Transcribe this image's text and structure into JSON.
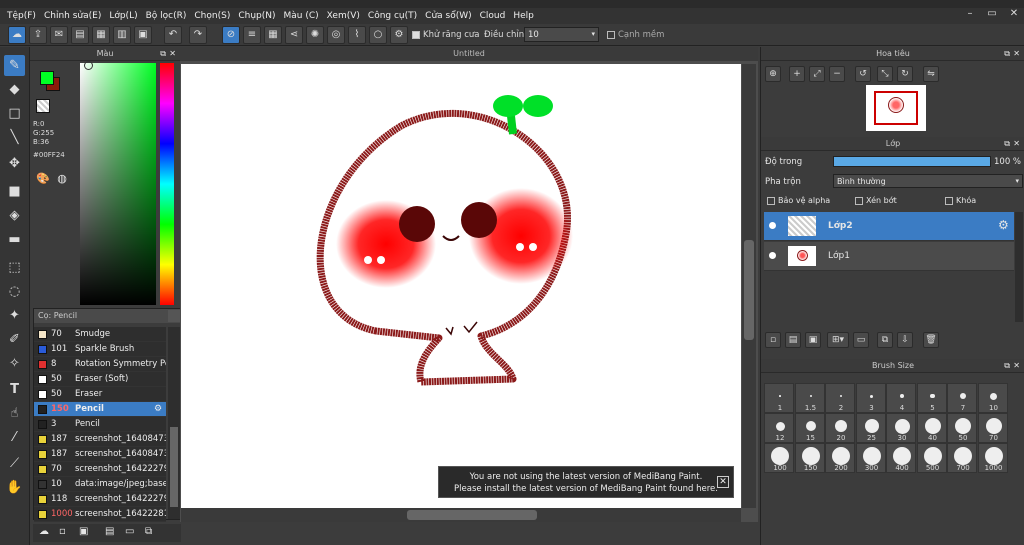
{
  "menu": [
    "Tệp(F)",
    "Chỉnh sửa(E)",
    "Lớp(L)",
    "Bộ lọc(R)",
    "Chọn(S)",
    "Chụp(N)",
    "Màu (C)",
    "Xem(V)",
    "Công cụ(T)",
    "Cửa sổ(W)",
    "Cloud",
    "Help"
  ],
  "toolbar": {
    "antialias_label": "Khử răng cưa",
    "adjust_label": "Điều chỉnh",
    "adjust_value": "10",
    "sharpen_label": "Cạnh mềm"
  },
  "color_panel": {
    "title": "Màu",
    "r": "R:0",
    "g": "G:255",
    "b": "B:36",
    "hex": "#00FF24",
    "foreground": "#00ff24",
    "background": "#8b1a0a"
  },
  "brush_panel": {
    "title": "Cọ: Pencil",
    "items": [
      {
        "size": "70",
        "name": "Smudge",
        "color": "#f5e6c8"
      },
      {
        "size": "101",
        "name": "Sparkle Brush",
        "color": "#2a5bd8"
      },
      {
        "size": "8",
        "name": "Rotation Symmetry Pe",
        "color": "#e03030"
      },
      {
        "size": "50",
        "name": "Eraser (Soft)",
        "color": "#ffffff"
      },
      {
        "size": "50",
        "name": "Eraser",
        "color": "#ffffff"
      },
      {
        "size": "150",
        "name": "Pencil",
        "color": "#222222"
      },
      {
        "size": "3",
        "name": "Pencil",
        "color": "#222222"
      },
      {
        "size": "187",
        "name": "screenshot_16408473",
        "color": "#e8d23a"
      },
      {
        "size": "187",
        "name": "screenshot_16408473",
        "color": "#e8d23a"
      },
      {
        "size": "70",
        "name": "screenshot_16422279",
        "color": "#e8d23a"
      },
      {
        "size": "10",
        "name": "data:image/jpeg;base",
        "color": "#e8d23a"
      },
      {
        "size": "118",
        "name": "screenshot_16422279",
        "color": "#e8d23a"
      },
      {
        "size": "1000",
        "name": "screenshot_16422281",
        "color": "#e8d23a"
      }
    ]
  },
  "document": {
    "tab_title": "Untitled"
  },
  "notice": {
    "line1": "You are not using the latest version of MediBang Paint.",
    "line2": "Please install the latest version of MediBang Paint found here."
  },
  "navigator": {
    "title": "Hoa tiêu"
  },
  "layer_panel": {
    "title": "Lớp",
    "opacity_label": "Độ trong",
    "opacity_value": "100 %",
    "opacity_fraction": 1.0,
    "blend_label": "Pha trộn",
    "blend_value": "Bình thường",
    "protect_alpha": "Bảo vệ alpha",
    "clipping": "Xén bớt",
    "lock": "Khóa",
    "layers": [
      {
        "name": "Lớp2",
        "selected": true
      },
      {
        "name": "Lớp1",
        "selected": false
      }
    ]
  },
  "brush_size_panel": {
    "title": "Brush Size",
    "sizes": [
      "1",
      "1.5",
      "2",
      "3",
      "4",
      "5",
      "7",
      "10",
      "12",
      "15",
      "20",
      "25",
      "30",
      "40",
      "50",
      "70",
      "100",
      "150",
      "200",
      "300",
      "400",
      "500",
      "700",
      "1000"
    ]
  }
}
